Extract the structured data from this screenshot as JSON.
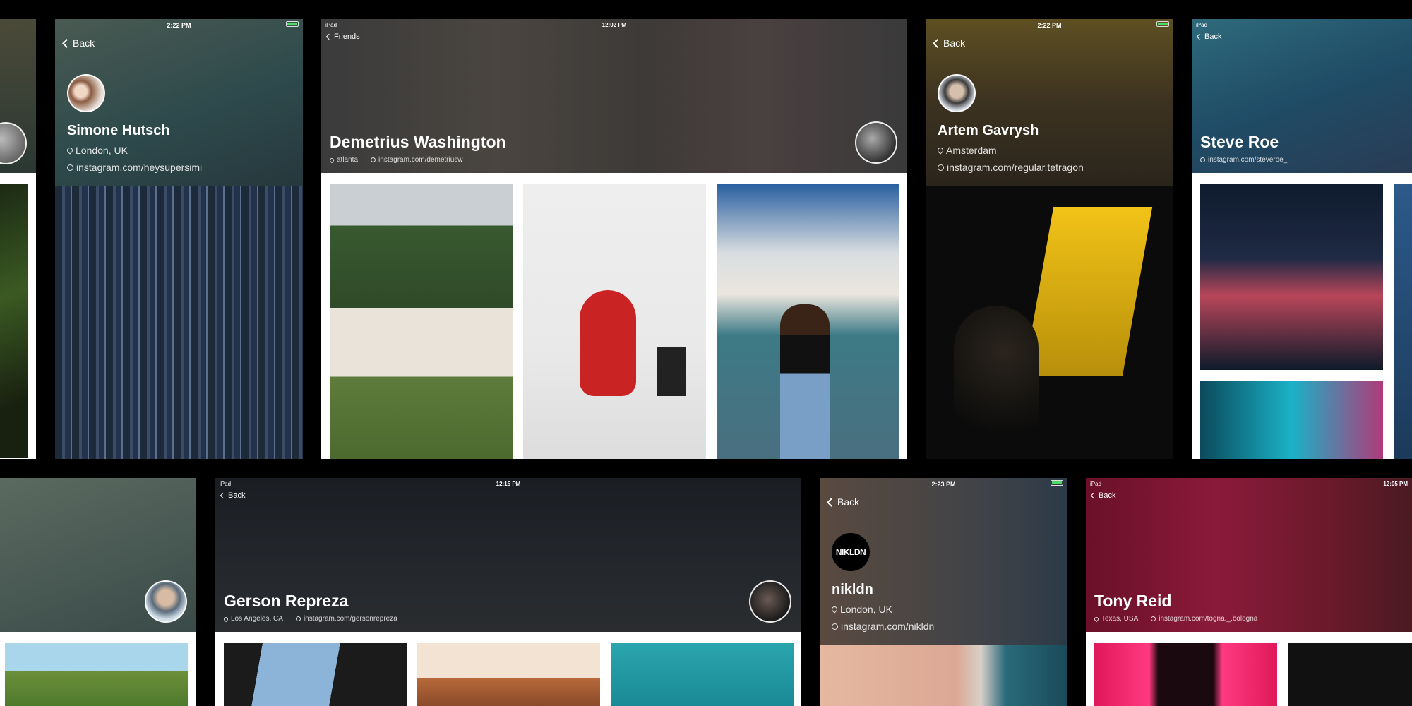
{
  "cards": {
    "simone": {
      "time": "2:22 PM",
      "back_label": "Back",
      "name": "Simone Hutsch",
      "location": "London, UK",
      "link": "instagram.com/heysupersimi"
    },
    "demetrius": {
      "device": "iPad",
      "time": "12:02 PM",
      "back_label": "Friends",
      "name": "Demetrius Washington",
      "location": "atlanta",
      "link": "instagram.com/demetriusw"
    },
    "artem": {
      "time": "2:22 PM",
      "back_label": "Back",
      "name": "Artem Gavrysh",
      "location": "Amsterdam",
      "link": "instagram.com/regular.tetragon"
    },
    "steve": {
      "device": "iPad",
      "back_label": "Back",
      "name": "Steve Roe",
      "link": "instagram.com/steveroe_"
    },
    "gerson": {
      "device": "iPad",
      "time": "12:15 PM",
      "back_label": "Back",
      "name": "Gerson Repreza",
      "location": "Los Angeles, CA",
      "link": "instagram.com/gersonrepreza"
    },
    "nikldn": {
      "time": "2:23 PM",
      "back_label": "Back",
      "avatar_text": "NIKLDN",
      "name": "nikldn",
      "location": "London, UK",
      "link": "instagram.com/nikldn"
    },
    "tony": {
      "device": "iPad",
      "time": "12:05 PM",
      "back_label": "Back",
      "name": "Tony Reid",
      "location": "Texas, USA",
      "link": "instagram.com/togna._.bologna"
    }
  },
  "colors": {
    "background": "#000000",
    "battery_green": "#4cd964"
  }
}
